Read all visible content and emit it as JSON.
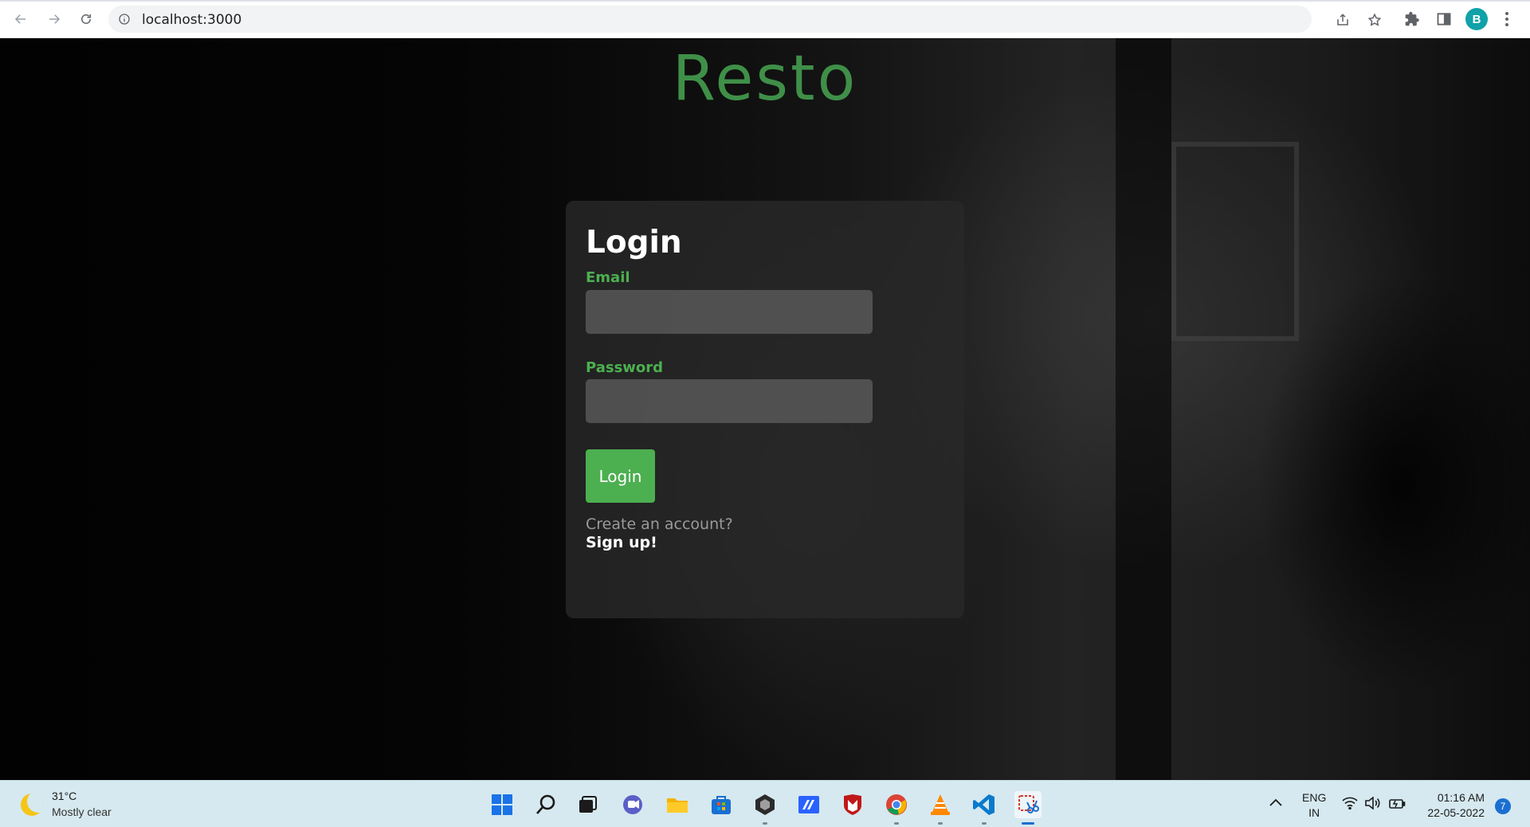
{
  "browser": {
    "url": "localhost:3000",
    "profile_initial": "B",
    "icons": {
      "back": "back-arrow-icon",
      "forward": "forward-arrow-icon",
      "reload": "reload-icon",
      "info": "info-icon",
      "share": "share-icon",
      "bookmark": "star-icon",
      "extensions": "puzzle-icon",
      "sidepanel": "side-panel-icon",
      "menu": "more-vert-icon"
    }
  },
  "page": {
    "brand": "Resto",
    "login": {
      "title": "Login",
      "email_label": "Email",
      "email_value": "",
      "password_label": "Password",
      "password_value": "",
      "submit_label": "Login",
      "create_account_text": "Create an account?",
      "signup_link": "Sign up!"
    },
    "colors": {
      "brand": "#3f8f48",
      "accent": "#4caf50"
    }
  },
  "taskbar": {
    "weather": {
      "temp": "31°C",
      "desc": "Mostly clear",
      "icon": "moon-icon"
    },
    "apps": [
      {
        "name": "start-icon",
        "label": "Start"
      },
      {
        "name": "search-icon",
        "label": "Search"
      },
      {
        "name": "task-view-icon",
        "label": "Task View"
      },
      {
        "name": "chat-icon",
        "label": "Chat"
      },
      {
        "name": "file-explorer-icon",
        "label": "File Explorer"
      },
      {
        "name": "store-icon",
        "label": "Microsoft Store"
      },
      {
        "name": "unity-icon",
        "label": "Unity"
      },
      {
        "name": "app-icon",
        "label": "App"
      },
      {
        "name": "mcafee-icon",
        "label": "McAfee"
      },
      {
        "name": "chrome-icon",
        "label": "Chrome"
      },
      {
        "name": "vlc-icon",
        "label": "VLC"
      },
      {
        "name": "vscode-icon",
        "label": "VS Code"
      },
      {
        "name": "snipping-tool-icon",
        "label": "Snipping Tool"
      }
    ],
    "language_line1": "ENG",
    "language_line2": "IN",
    "time": "01:16 AM",
    "date": "22-05-2022",
    "notification_count": "7"
  }
}
